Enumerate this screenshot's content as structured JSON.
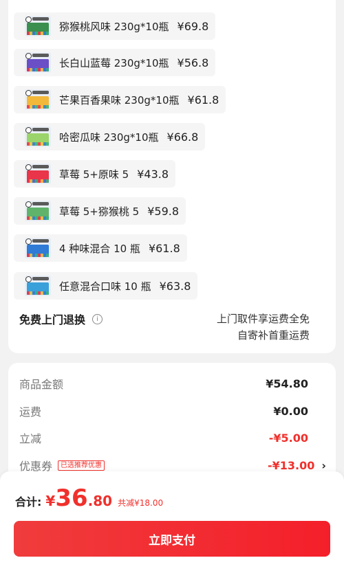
{
  "variants": [
    {
      "name": "猕猴桃风味 230g*10瓶",
      "price": "¥69.8",
      "pack_color": "#3a8f4e"
    },
    {
      "name": "长白山蓝莓 230g*10瓶",
      "price": "¥56.8",
      "pack_color": "#6a4fc7"
    },
    {
      "name": "芒果百香果味 230g*10瓶",
      "price": "¥61.8",
      "pack_color": "#f3b83a"
    },
    {
      "name": "哈密瓜味 230g*10瓶",
      "price": "¥66.8",
      "pack_color": "#9bd46a"
    },
    {
      "name": "草莓 5+原味 5",
      "price": "¥43.8",
      "pack_color": "#e9344a"
    },
    {
      "name": "草莓 5+猕猴桃 5",
      "price": "¥59.8",
      "pack_color": "#5fb36b"
    },
    {
      "name": "4 种味混合 10 瓶",
      "price": "¥61.8",
      "pack_color": "#2f7bd6"
    },
    {
      "name": "任意混合口味 10 瓶",
      "price": "¥63.8",
      "pack_color": "#3aa0d9"
    }
  ],
  "returns": {
    "label": "免费上门退换",
    "info_icon": "ⓘ",
    "line1": "上门取件享运费全免",
    "line2": "自寄补首重运费"
  },
  "summary": {
    "goods_label": "商品金额",
    "goods_value": "¥54.80",
    "shipping_label": "运费",
    "shipping_value": "¥0.00",
    "discount_label": "立减",
    "discount_value": "-¥5.00",
    "coupon_label": "优惠券",
    "coupon_tag": "已选推荐优惠",
    "coupon_value": "-¥13.00",
    "coupon_chevron": "›"
  },
  "checkout": {
    "total_label": "合计:",
    "currency": "¥",
    "total_int": "36",
    "total_dec": ".80",
    "saved": "共减¥18.00",
    "pay_label": "立即支付"
  },
  "colors": {
    "accent": "#f0302c",
    "button": "#f22a2e"
  }
}
